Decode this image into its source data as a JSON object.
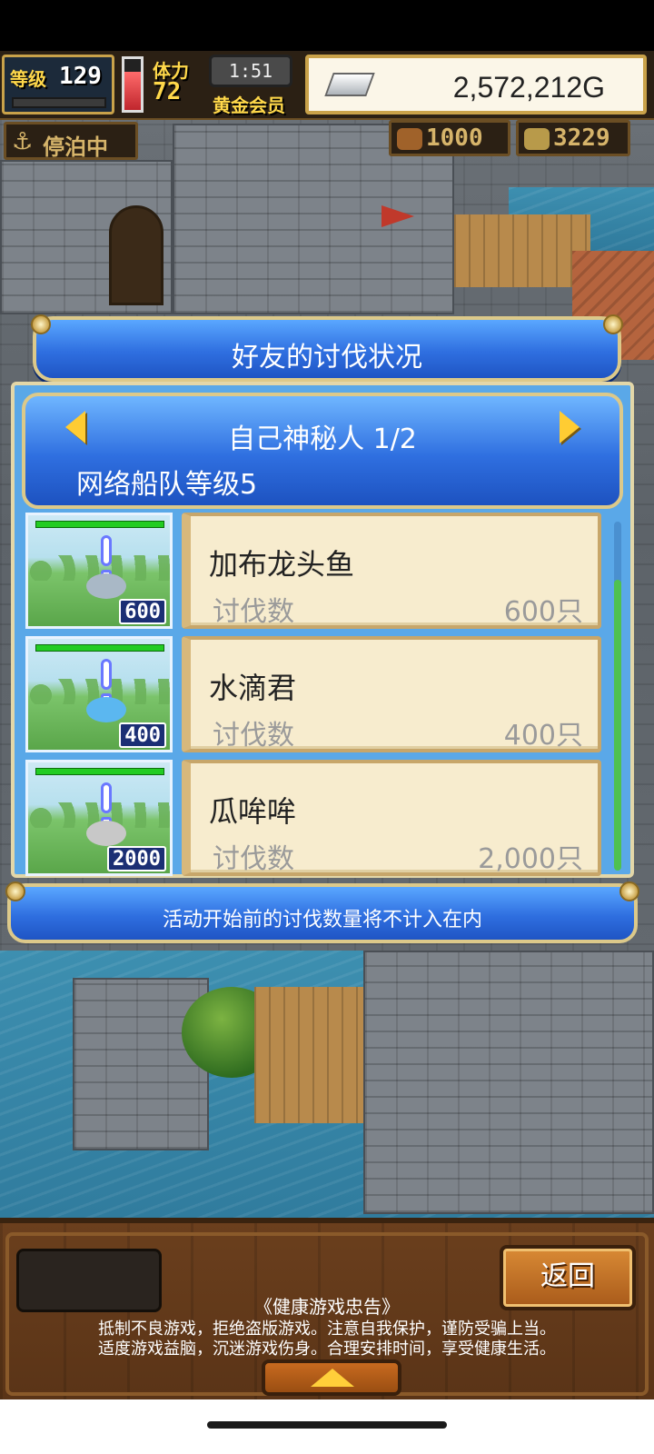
{
  "hud": {
    "level_label": "等级",
    "level_value": "129",
    "stamina_label": "体力",
    "stamina_value": "72",
    "time": "1:51",
    "member_label": "黄金会员",
    "gold": "2,572,212G",
    "anchor_label": "停泊中",
    "resource1_value": "1000",
    "resource2_value": "3229",
    "stamina_level": 0.75,
    "icons": {
      "silver": "silver-ingot-icon",
      "anchor": "anchor-icon",
      "res1": "cannonball-icon",
      "res2": "coin-icon"
    }
  },
  "dialog": {
    "title": "好友的讨伐状况",
    "page_title": "自己神秘人 1/2",
    "fleet_level": "网络船队等级5",
    "rows": [
      {
        "name": "加布龙头鱼",
        "count_label": "讨伐数",
        "count_value": "600只",
        "badge": "600",
        "monster_color": "#a9b8c6"
      },
      {
        "name": "水滴君",
        "count_label": "讨伐数",
        "count_value": "400只",
        "badge": "400",
        "monster_color": "#5bb7f0"
      },
      {
        "name": "瓜哞哞",
        "count_label": "讨伐数",
        "count_value": "2,000只",
        "badge": "2000",
        "monster_color": "#c8c8c8"
      }
    ],
    "notice": "活动开始前的讨伐数量将不计入在内"
  },
  "bottom": {
    "back_label": "返回",
    "health_title": "《健康游戏忠告》",
    "health_line1": "抵制不良游戏，拒绝盗版游戏。注意自我保护，谨防受骗上当。",
    "health_line2": "适度游戏益脑，沉迷游戏伤身。合理安排时间，享受健康生活。"
  },
  "colors": {
    "accent_blue": "#2f6fe0",
    "card_bg": "#f7ecce",
    "gold_border": "#dcc98a"
  }
}
